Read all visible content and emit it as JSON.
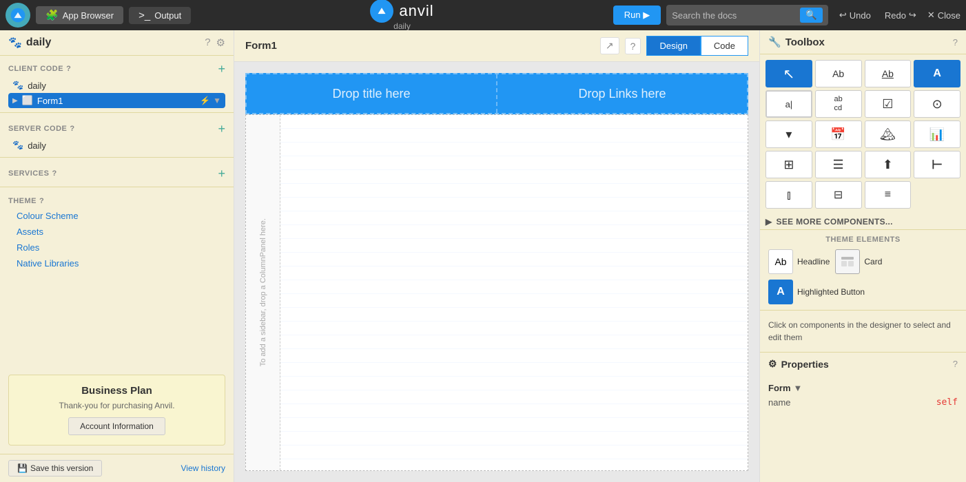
{
  "topbar": {
    "logo_alt": "Anvil Logo",
    "app_browser_label": "App Browser",
    "output_label": "Output",
    "brand_name": "anvil",
    "app_name": "daily",
    "run_label": "Run ▶",
    "search_placeholder": "Search the docs",
    "search_icon": "🔍",
    "undo_label": "Undo",
    "redo_label": "Redo",
    "close_label": "Close"
  },
  "left_panel": {
    "title": "daily",
    "help_icon": "?",
    "settings_icon": "⚙",
    "sections": {
      "client_code": {
        "title": "CLIENT CODE",
        "items": [
          {
            "label": "daily",
            "type": "module",
            "icon": "🐾"
          },
          {
            "label": "Form1",
            "type": "form",
            "icon": "⬜",
            "selected": true
          }
        ]
      },
      "server_code": {
        "title": "SERVER CODE",
        "items": [
          {
            "label": "daily",
            "type": "module",
            "icon": "🐾"
          }
        ]
      },
      "services": {
        "title": "SERVICES"
      },
      "theme": {
        "title": "THEME",
        "links": [
          "Colour Scheme",
          "Assets",
          "Roles",
          "Native Libraries"
        ]
      }
    },
    "business_plan": {
      "title": "Business Plan",
      "text": "Thank-you for purchasing Anvil.",
      "button": "Account Information"
    },
    "footer": {
      "save_label": "Save this version",
      "view_history_label": "View history"
    }
  },
  "center_panel": {
    "form_title": "Form1",
    "tabs": [
      "Design",
      "Code"
    ],
    "active_tab": "Design",
    "drop_title": "Drop title here",
    "drop_links": "Drop Links here",
    "sidebar_hint": "To add a sidebar, drop a ColumnPanel here."
  },
  "right_panel": {
    "toolbox_title": "Toolbox",
    "tools": [
      {
        "name": "cursor",
        "symbol": "↖",
        "selected": true
      },
      {
        "name": "text-label",
        "symbol": "Ab"
      },
      {
        "name": "link",
        "symbol": "Ab",
        "underline": true
      },
      {
        "name": "button",
        "symbol": "A",
        "style": "filled"
      },
      {
        "name": "text-box",
        "symbol": "a|",
        "style": "outlined"
      },
      {
        "name": "multiline-text",
        "symbol": "ab\ncd"
      },
      {
        "name": "checkbox",
        "symbol": "☑"
      },
      {
        "name": "radio",
        "symbol": "⚬"
      },
      {
        "name": "dropdown",
        "symbol": "▾"
      },
      {
        "name": "date-picker",
        "symbol": "📅"
      },
      {
        "name": "image",
        "symbol": "🖼"
      },
      {
        "name": "bar-chart",
        "symbol": "📊"
      },
      {
        "name": "data-grid",
        "symbol": "⊞"
      },
      {
        "name": "repeating-panel",
        "symbol": "☰"
      },
      {
        "name": "file-loader",
        "symbol": "⬆"
      },
      {
        "name": "label-aligned",
        "symbol": "⊢"
      },
      {
        "name": "column-panel",
        "symbol": "⫾"
      },
      {
        "name": "flow-panel",
        "symbol": "⊟"
      },
      {
        "name": "list",
        "symbol": "☰"
      }
    ],
    "see_more_label": "SEE MORE COMPONENTS...",
    "theme_elements_title": "THEME ELEMENTS",
    "theme_items": [
      {
        "name": "headline",
        "icon_text": "Ab",
        "label": "Headline",
        "style": "plain"
      },
      {
        "name": "card",
        "icon_text": "⊞",
        "label": "Card",
        "style": "outlined"
      },
      {
        "name": "highlighted-button",
        "icon_text": "A",
        "label": "Highlighted Button",
        "style": "blue"
      }
    ],
    "info_text": "Click on components in the designer to select and edit them",
    "properties_title": "Properties",
    "properties": {
      "section_label": "Form",
      "rows": [
        {
          "label": "name",
          "value": "self"
        }
      ]
    }
  }
}
